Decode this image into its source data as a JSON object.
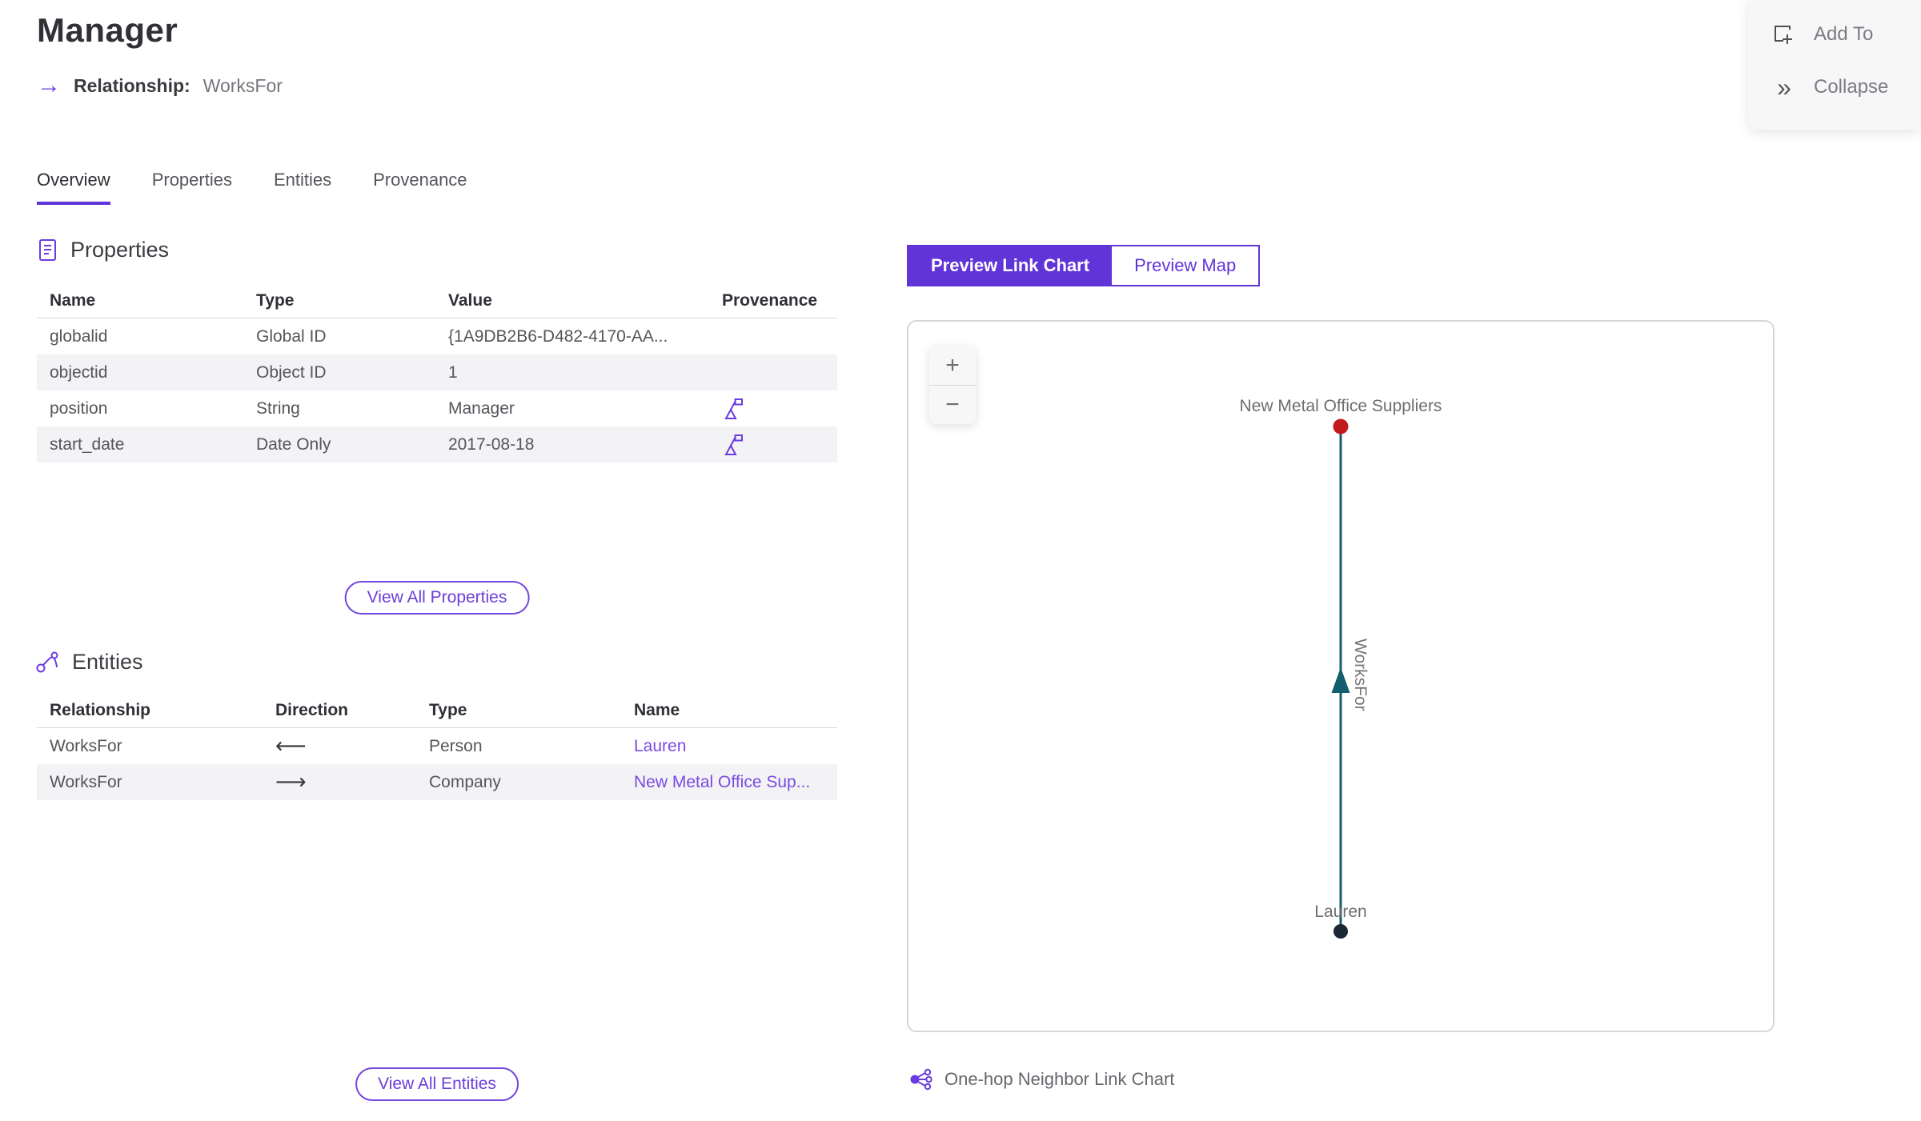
{
  "header": {
    "title": "Manager",
    "subtitle_label": "Relationship:",
    "subtitle_value": "WorksFor"
  },
  "icons": {
    "relationship_arrow": "→",
    "collapse_chevrons": "»"
  },
  "actions": {
    "add_to": "Add To",
    "collapse": "Collapse"
  },
  "tabs": [
    {
      "label": "Overview",
      "active": true
    },
    {
      "label": "Properties",
      "active": false
    },
    {
      "label": "Entities",
      "active": false
    },
    {
      "label": "Provenance",
      "active": false
    }
  ],
  "properties_section": {
    "title": "Properties",
    "columns": [
      "Name",
      "Type",
      "Value",
      "Provenance"
    ],
    "rows": [
      {
        "name": "globalid",
        "type": "Global ID",
        "value": "{1A9DB2B6-D482-4170-AA...",
        "has_provenance": false
      },
      {
        "name": "objectid",
        "type": "Object ID",
        "value": "1",
        "has_provenance": false
      },
      {
        "name": "position",
        "type": "String",
        "value": "Manager",
        "has_provenance": true
      },
      {
        "name": "start_date",
        "type": "Date Only",
        "value": "2017-08-18",
        "has_provenance": true
      }
    ],
    "view_all_label": "View All Properties"
  },
  "entities_section": {
    "title": "Entities",
    "columns": [
      "Relationship",
      "Direction",
      "Type",
      "Name"
    ],
    "rows": [
      {
        "relationship": "WorksFor",
        "direction": "incoming",
        "direction_glyph": "⟵",
        "type": "Person",
        "name": "Lauren"
      },
      {
        "relationship": "WorksFor",
        "direction": "outgoing",
        "direction_glyph": "⟶",
        "type": "Company",
        "name": "New Metal Office Sup..."
      }
    ],
    "view_all_label": "View All Entities"
  },
  "preview": {
    "toggle": [
      {
        "label": "Preview Link Chart",
        "selected": true
      },
      {
        "label": "Preview Map",
        "selected": false
      }
    ],
    "zoom_in": "+",
    "zoom_out": "−",
    "caption": "One-hop Neighbor Link Chart"
  },
  "link_chart": {
    "type": "node-link",
    "nodes": [
      {
        "label": "New Metal Office Suppliers",
        "color": "#c2191c",
        "position": "top"
      },
      {
        "label": "Lauren",
        "color": "#1b2733",
        "position": "bottom"
      }
    ],
    "edge": {
      "label": "WorksFor",
      "color": "#135e6e",
      "direction": "bottom-to-top"
    }
  },
  "colors": {
    "accent_purple": "#6134d8",
    "icon_purple": "#6a3be0",
    "link_purple": "#7a4be0",
    "edge_teal": "#135e6e",
    "node_red": "#c2191c",
    "node_dark": "#1b2733",
    "row_alt": "#f3f3f6"
  }
}
